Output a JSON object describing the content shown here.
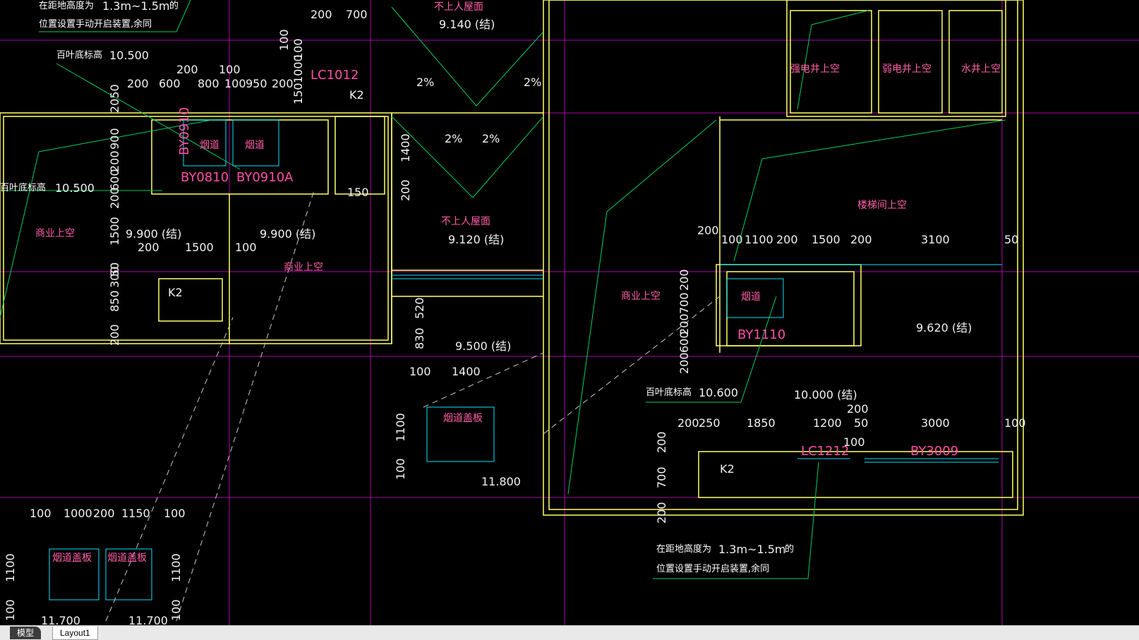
{
  "tabs": {
    "model": "模型",
    "layout1": "Layout1"
  },
  "colors": {
    "background": "#000000",
    "dimension": "#00ff40",
    "wall": "#ffff66",
    "grid_axis": "#ff00ff",
    "room_label": "#ff5fa8",
    "duct": "#00e5ff"
  },
  "labels": {
    "top_note_height": "在距地高度为",
    "top_note_range": "1.3m~1.5m",
    "top_note_de": "的",
    "top_note_line2": "位置设置手动开启装置,余同",
    "louver_label_a": "百叶底标高",
    "louver_val_a": "10.500",
    "louver_label_b": "百叶底标高",
    "louver_val_b": "10.500",
    "louver_label_c": "百叶底标高",
    "louver_val_c": "10.600",
    "roof_top": "不上人屋面",
    "roof_top_level": "9.140 (结)",
    "roof_mid": "不上人屋面",
    "roof_mid_level": "9.120 (结)",
    "slope": "2%",
    "smoke_duct": "烟道",
    "commercial_void": "商业上空",
    "stair_void": "楼梯间上空",
    "strong_shaft": "强电井上空",
    "weak_shaft": "弱电井上空",
    "water_shaft": "水井上空",
    "smoke_cover": "烟道盖板",
    "level_9900": "9.900 (结)",
    "level_9500": "9.500 (结)",
    "level_9620": "9.620 (结)",
    "level_10000": "10.000 (结)",
    "level_11800": "11.800",
    "level_11700": "11.700",
    "bottom_note_height": "在距地高度为",
    "bottom_note_range": "1.3m~1.5m",
    "bottom_note_de": "的",
    "bottom_note_line2": "位置设置手动开启装置,余同",
    "by0910": "BY0910",
    "by0810": "BY0810",
    "by0910a": "BY0910A",
    "by1110": "BY1110",
    "by0810b": "BY0810",
    "by3009": "BY3009",
    "lc1012": "LC1012",
    "lc1212": "LC1212",
    "k2": "K2"
  },
  "dims": {
    "d200": "200",
    "d700": "700",
    "d100": "100",
    "d600": "600",
    "d800": "800",
    "d950": "950",
    "d1000": "1000",
    "d150": "150",
    "d900": "900",
    "d1500": "1500",
    "d50": "50",
    "d300": "300",
    "d850": "850",
    "d1400": "1400",
    "d520": "520",
    "d830": "830",
    "d1100": "1100",
    "d3100": "3100",
    "d250": "250",
    "d1850": "1850",
    "d1200": "1200",
    "d3000": "3000",
    "d1150": "1150",
    "d2050": "2050"
  }
}
